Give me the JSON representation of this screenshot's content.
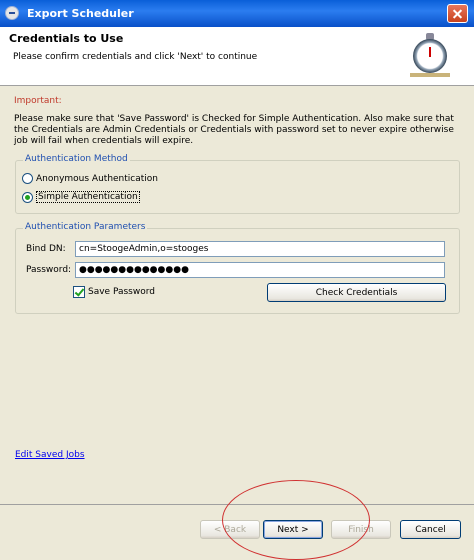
{
  "window": {
    "title": "Export Scheduler"
  },
  "header": {
    "title": "Credentials to Use",
    "description": "Please confirm credentials and click 'Next' to continue",
    "icon": "stopwatch-icon"
  },
  "content": {
    "important_label": "Important:",
    "message": "Please make sure that 'Save Password' is Checked for Simple Authentication. Also make sure that the Credentials are Admin Credentials or Credentials with password set to never expire otherwise job will fail when credentials will expire.",
    "auth_method": {
      "legend": "Authentication Method",
      "options": [
        {
          "label": "Anonymous Authentication",
          "selected": false
        },
        {
          "label": "Simple Authentication",
          "selected": true
        }
      ]
    },
    "auth_params": {
      "legend": "Authentication Parameters",
      "bind_dn_label": "Bind DN:",
      "bind_dn_value": "cn=StoogeAdmin,o=stooges",
      "password_label": "Password:",
      "password_value": "●●●●●●●●●●●●●●",
      "save_password_label": "Save Password",
      "save_password_checked": true,
      "check_credentials_label": "Check Credentials"
    },
    "edit_saved_jobs_link": "Edit Saved Jobs"
  },
  "footer": {
    "back_label": "< Back",
    "next_label": "Next >",
    "finish_label": "Finish",
    "cancel_label": "Cancel"
  },
  "colors": {
    "titlebar": "#0a5fd8",
    "important": "#c0392b",
    "group_label": "#1f4fb0",
    "annotation": "#d03030"
  }
}
